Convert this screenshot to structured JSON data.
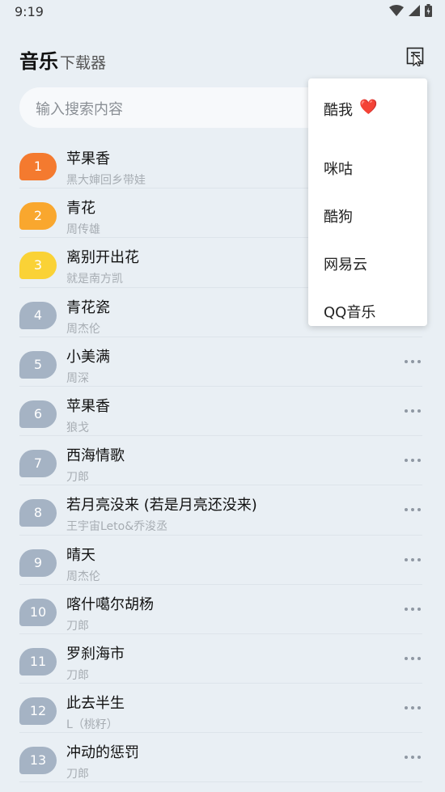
{
  "status_bar": {
    "time": "9:19"
  },
  "header": {
    "title": "音乐",
    "subtitle": "下载器"
  },
  "search": {
    "placeholder": "输入搜索内容"
  },
  "songs": [
    {
      "rank": "1",
      "title": "苹果香",
      "artist": "黑大婶回乡带娃"
    },
    {
      "rank": "2",
      "title": "青花",
      "artist": "周传雄"
    },
    {
      "rank": "3",
      "title": "离别开出花",
      "artist": "就是南方凯"
    },
    {
      "rank": "4",
      "title": "青花瓷",
      "artist": "周杰伦"
    },
    {
      "rank": "5",
      "title": "小美满",
      "artist": "周深"
    },
    {
      "rank": "6",
      "title": "苹果香",
      "artist": "狼戈"
    },
    {
      "rank": "7",
      "title": "西海情歌",
      "artist": "刀郎"
    },
    {
      "rank": "8",
      "title": "若月亮没来 (若是月亮还没来)",
      "artist": "王宇宙Leto&乔浚丞"
    },
    {
      "rank": "9",
      "title": "晴天",
      "artist": "周杰伦"
    },
    {
      "rank": "10",
      "title": "喀什噶尔胡杨",
      "artist": "刀郎"
    },
    {
      "rank": "11",
      "title": "罗刹海市",
      "artist": "刀郎"
    },
    {
      "rank": "12",
      "title": "此去半生",
      "artist": "L（桃籽）"
    },
    {
      "rank": "13",
      "title": "冲动的惩罚",
      "artist": "刀郎"
    }
  ],
  "source_menu": {
    "items": [
      {
        "label": "酷我",
        "icon": "heart-icon"
      },
      {
        "label": "咪咕"
      },
      {
        "label": "酷狗"
      },
      {
        "label": "网易云"
      },
      {
        "label": "QQ音乐"
      }
    ]
  },
  "colors": {
    "background": "#e9eff4",
    "rank_1": "#f47a2f",
    "rank_2": "#f9a72e",
    "rank_3": "#fad236",
    "rank_default": "#a5b3c4"
  }
}
